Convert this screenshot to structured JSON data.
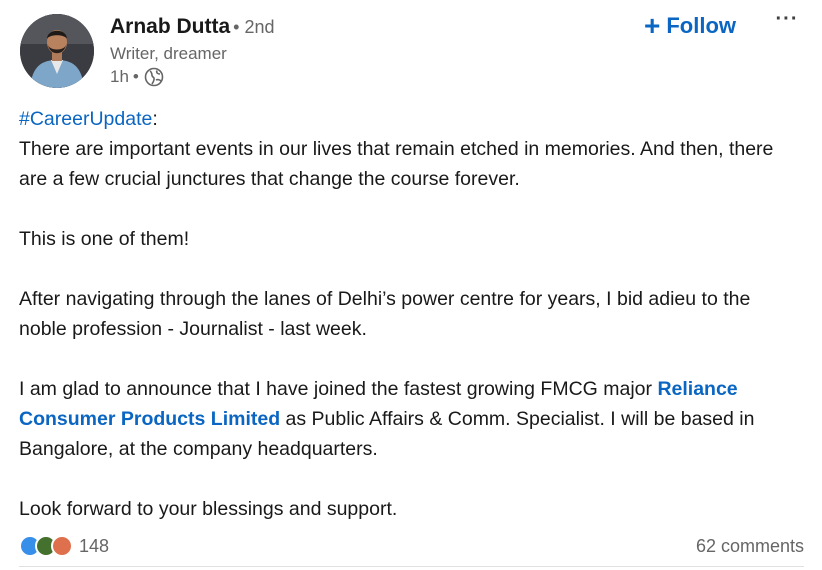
{
  "author": {
    "name": "Arnab Dutta",
    "degree": "• 2nd",
    "headline": "Writer, dreamer",
    "time": "1h",
    "visibility_icon": "globe-icon"
  },
  "actions": {
    "follow_icon": "+",
    "follow_label": "Follow",
    "more_label": "···"
  },
  "post": {
    "hashtag": "#CareerUpdate",
    "hashtag_suffix": ":",
    "para1": "There are important events in our lives that remain etched in memories. And then, there are a few crucial junctures that change the course forever.",
    "para2": "This is one of them!",
    "para3": "After navigating through the lanes of Delhi’s power centre for years, I bid adieu to the noble profession - Journalist - last week.",
    "para4_before": "I am glad to announce that I have joined the fastest growing FMCG major ",
    "para4_link": "Reliance Consumer Products Limited",
    "para4_after": " as Public Affairs & Comm. Specialist. I will be based in Bangalore, at the company headquarters.",
    "para5": "Look forward to your blessings and support."
  },
  "social": {
    "reaction_icons": [
      "clap-icon",
      "support-icon",
      "love-icon"
    ],
    "reaction_colors": [
      "#378fe9",
      "#44712e",
      "#df704d"
    ],
    "reactions_count": "148",
    "comments": "62 comments"
  },
  "colors": {
    "accent": "#0a66c2",
    "text": "#191919",
    "muted": "#666666"
  }
}
